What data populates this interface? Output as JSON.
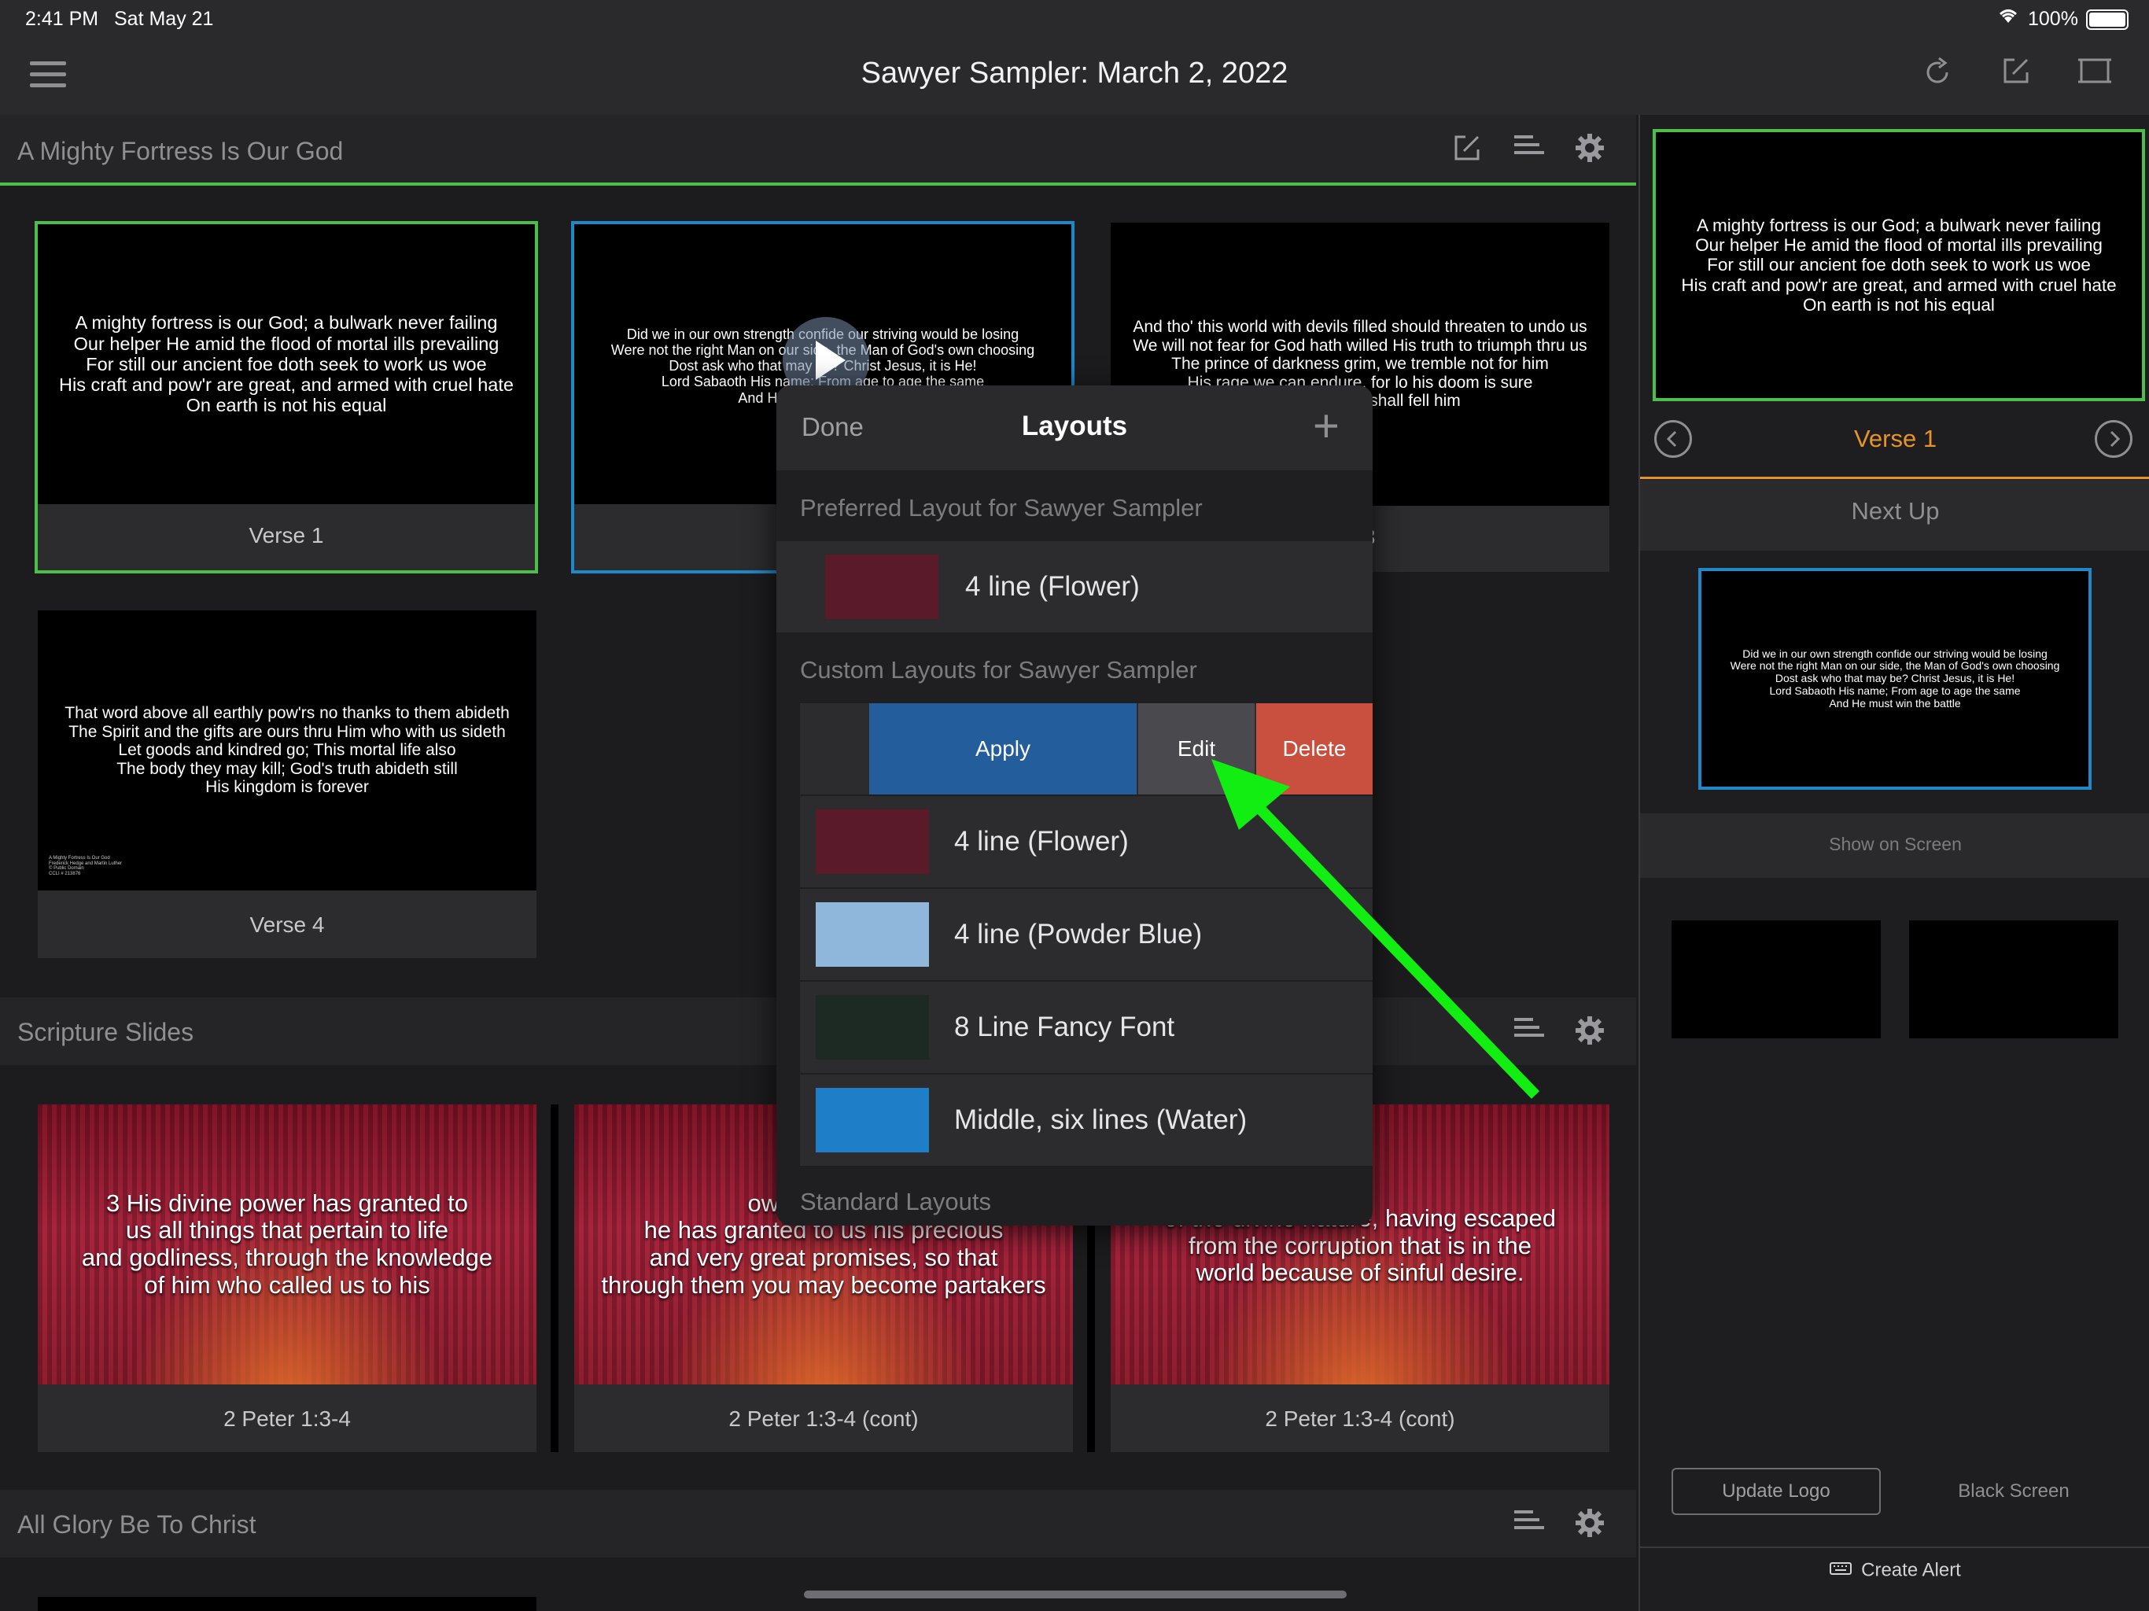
{
  "status_bar": {
    "time": "2:41 PM",
    "date": "Sat May 21",
    "battery": "100%"
  },
  "app_title": "Sawyer Sampler: March 2, 2022",
  "top_icons": [
    "menu-icon",
    "refresh-icon",
    "edit-icon",
    "screen-icon"
  ],
  "sections": [
    {
      "title": "A Mighty Fortress Is Our God",
      "slides": [
        {
          "caption": "Verse 1",
          "text": "A mighty fortress is our God; a bulwark never failing\nOur helper He amid the flood of mortal ills prevailing\nFor still our ancient foe doth seek to work us woe\nHis craft and pow'r are great, and armed with cruel hate\nOn earth is not his equal"
        },
        {
          "caption": "",
          "text": "Did we in our own strength confide our striving would be losing\nWere not the right Man on our side, the Man of God's own choosing\nDost ask who that may be? Christ Jesus, it is He!\nLord Sabaoth His name; From age to age the same\nAnd He must win the battle"
        },
        {
          "caption": "e 3",
          "text": "And tho' this world with devils filled should threaten to undo us\nWe will not fear for God hath willed His truth to triumph thru us\nThe prince of darkness grim, we tremble not for him\nHis rage we can endure, for lo his doom is sure\nOne little word shall fell him"
        },
        {
          "caption": "Verse 4",
          "text": "That word above all earthly pow'rs no thanks to them abideth\nThe Spirit and the gifts are ours thru Him who with us sideth\nLet goods and kindred go; This mortal life also\nThe body they may kill; God's truth abideth still\nHis kingdom is forever",
          "credits": "A Mighty Fortress Is Our God\nFrederick Hedge and Martin Luther\n© Public Domain\nCCLI # 213876"
        }
      ]
    },
    {
      "title": "Scripture Slides",
      "slides": [
        {
          "caption": "2 Peter 1:3-4",
          "text": "3 His divine power has granted to\nus all things that pertain to life\nand godliness, through the knowledge\nof him who called us to his"
        },
        {
          "caption": "2 Peter 1:3-4 (cont)",
          "text": "own glory and\nhe has granted to us his precious\nand very great promises, so that\nthrough them you may become partakers"
        },
        {
          "caption": "2 Peter 1:3-4 (cont)",
          "text": "of the divine nature, having escaped\nfrom the corruption that is in the\nworld because of sinful desire."
        }
      ]
    },
    {
      "title": "All Glory Be To Christ",
      "slides": []
    }
  ],
  "popover": {
    "done_label": "Done",
    "title": "Layouts",
    "add_symbol": "+",
    "preferred_header": "Preferred Layout for Sawyer Sampler",
    "preferred": [
      {
        "label": "4 line (Flower)",
        "thumb_color": "#5a1a2a"
      }
    ],
    "custom_header": "Custom Layouts for Sawyer Sampler",
    "swipe_actions": {
      "apply": "Apply",
      "edit": "Edit",
      "delete": "Delete"
    },
    "custom": [
      {
        "label": "4 line (Flower)",
        "thumb_color": "#5a1a2a"
      },
      {
        "label": "4 line (Powder Blue)",
        "thumb_color": "#8fb7dc"
      },
      {
        "label": "8 Line Fancy Font",
        "thumb_color": "#1d2a24"
      },
      {
        "label": "Middle, six lines (Water)",
        "thumb_color": "#1e7fc8"
      }
    ],
    "standard_header": "Standard Layouts"
  },
  "right_panel": {
    "live_text": "A mighty fortress is our God; a bulwark never failing\nOur helper He amid the flood of mortal ills prevailing\nFor still our ancient foe doth seek to work us woe\nHis craft and pow'r are great, and armed with cruel hate\nOn earth is not his equal",
    "current_label": "Verse 1",
    "next_up_label": "Next Up",
    "next_text": "Did we in our own strength confide our striving would be losing\nWere not the right Man on our side, the Man of God's own choosing\nDost ask who that may be? Christ Jesus, it is He!\nLord Sabaoth His name; From age to age the same\nAnd He must win the battle",
    "show_on_screen": "Show on Screen",
    "update_logo": "Update Logo",
    "black_screen": "Black Screen",
    "create_alert": "Create Alert"
  },
  "colors": {
    "live_green": "#4cbf4b",
    "next_blue": "#1e88c8",
    "accent_orange": "#e8932a",
    "apply_blue": "#245d9c",
    "edit_gray": "#4a4a4e",
    "delete_red": "#c9503e",
    "arrow_green": "#12ee12"
  }
}
